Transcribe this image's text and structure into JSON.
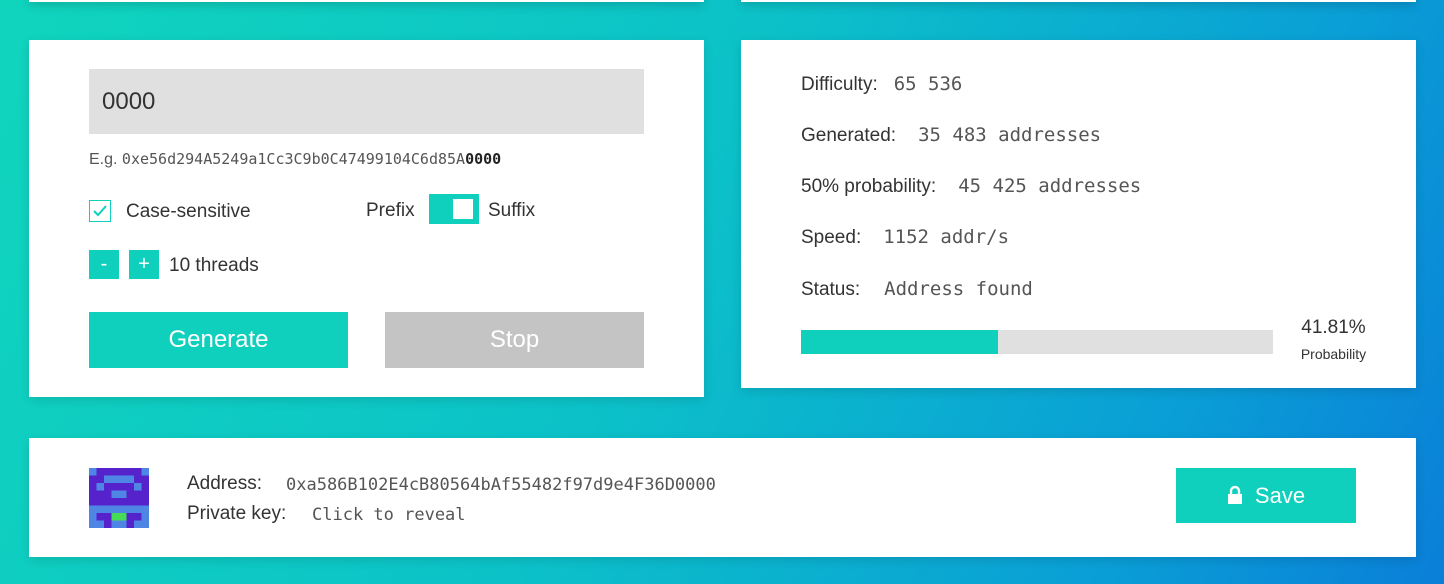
{
  "input": {
    "value": "0000"
  },
  "example": {
    "prefix": "E.g.",
    "address_start": "0xe56d294A5249a1Cc3C9b0C47499104C6d85A",
    "address_end": "0000"
  },
  "options": {
    "case_sensitive_label": "Case-sensitive",
    "case_sensitive_checked": true,
    "prefix_label": "Prefix",
    "suffix_label": "Suffix",
    "toggle_state": "suffix",
    "minus_label": "-",
    "plus_label": "+",
    "threads_label": "10 threads"
  },
  "buttons": {
    "generate": "Generate",
    "stop": "Stop"
  },
  "stats": {
    "difficulty_label": "Difficulty:",
    "difficulty_value": "65 536",
    "generated_label": "Generated:",
    "generated_value": "35 483 addresses",
    "probability50_label": "50% probability:",
    "probability50_value": "45 425 addresses",
    "speed_label": "Speed:",
    "speed_value": "1152 addr/s",
    "status_label": "Status:",
    "status_value": "Address found",
    "probability_value": "41.81%",
    "probability_fraction": 0.4181,
    "probability_label": "Probability"
  },
  "result": {
    "address_label": "Address:",
    "address_value": "0xa586B102E4cB80564bAf55482f97d9e4F36D0000",
    "private_key_label": "Private key:",
    "private_key_value": "Click to reveal",
    "save_label": "Save"
  },
  "colors": {
    "accent": "#0fd0bc",
    "disabled": "#c4c4c4",
    "identicon_bg": "#5522cc",
    "identicon_fg": "#4f86e6",
    "identicon_spot": "#44dd55"
  },
  "icons": {
    "check": "check-icon",
    "lock": "lock-icon",
    "identicon": "identicon"
  }
}
